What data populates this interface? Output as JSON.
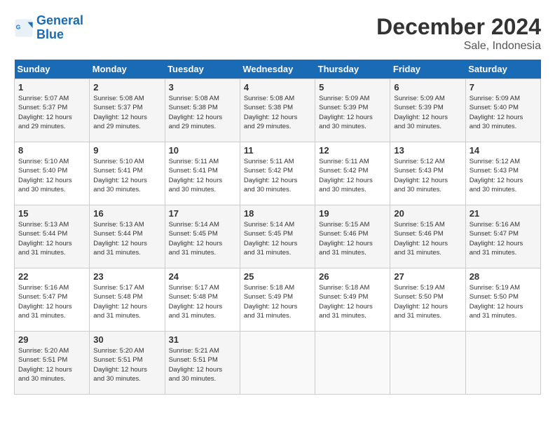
{
  "header": {
    "logo_line1": "General",
    "logo_line2": "Blue",
    "title": "December 2024",
    "subtitle": "Sale, Indonesia"
  },
  "days_of_week": [
    "Sunday",
    "Monday",
    "Tuesday",
    "Wednesday",
    "Thursday",
    "Friday",
    "Saturday"
  ],
  "weeks": [
    [
      {
        "day": "1",
        "info": "Sunrise: 5:07 AM\nSunset: 5:37 PM\nDaylight: 12 hours\nand 29 minutes."
      },
      {
        "day": "2",
        "info": "Sunrise: 5:08 AM\nSunset: 5:37 PM\nDaylight: 12 hours\nand 29 minutes."
      },
      {
        "day": "3",
        "info": "Sunrise: 5:08 AM\nSunset: 5:38 PM\nDaylight: 12 hours\nand 29 minutes."
      },
      {
        "day": "4",
        "info": "Sunrise: 5:08 AM\nSunset: 5:38 PM\nDaylight: 12 hours\nand 29 minutes."
      },
      {
        "day": "5",
        "info": "Sunrise: 5:09 AM\nSunset: 5:39 PM\nDaylight: 12 hours\nand 30 minutes."
      },
      {
        "day": "6",
        "info": "Sunrise: 5:09 AM\nSunset: 5:39 PM\nDaylight: 12 hours\nand 30 minutes."
      },
      {
        "day": "7",
        "info": "Sunrise: 5:09 AM\nSunset: 5:40 PM\nDaylight: 12 hours\nand 30 minutes."
      }
    ],
    [
      {
        "day": "8",
        "info": "Sunrise: 5:10 AM\nSunset: 5:40 PM\nDaylight: 12 hours\nand 30 minutes."
      },
      {
        "day": "9",
        "info": "Sunrise: 5:10 AM\nSunset: 5:41 PM\nDaylight: 12 hours\nand 30 minutes."
      },
      {
        "day": "10",
        "info": "Sunrise: 5:11 AM\nSunset: 5:41 PM\nDaylight: 12 hours\nand 30 minutes."
      },
      {
        "day": "11",
        "info": "Sunrise: 5:11 AM\nSunset: 5:42 PM\nDaylight: 12 hours\nand 30 minutes."
      },
      {
        "day": "12",
        "info": "Sunrise: 5:11 AM\nSunset: 5:42 PM\nDaylight: 12 hours\nand 30 minutes."
      },
      {
        "day": "13",
        "info": "Sunrise: 5:12 AM\nSunset: 5:43 PM\nDaylight: 12 hours\nand 30 minutes."
      },
      {
        "day": "14",
        "info": "Sunrise: 5:12 AM\nSunset: 5:43 PM\nDaylight: 12 hours\nand 30 minutes."
      }
    ],
    [
      {
        "day": "15",
        "info": "Sunrise: 5:13 AM\nSunset: 5:44 PM\nDaylight: 12 hours\nand 31 minutes."
      },
      {
        "day": "16",
        "info": "Sunrise: 5:13 AM\nSunset: 5:44 PM\nDaylight: 12 hours\nand 31 minutes."
      },
      {
        "day": "17",
        "info": "Sunrise: 5:14 AM\nSunset: 5:45 PM\nDaylight: 12 hours\nand 31 minutes."
      },
      {
        "day": "18",
        "info": "Sunrise: 5:14 AM\nSunset: 5:45 PM\nDaylight: 12 hours\nand 31 minutes."
      },
      {
        "day": "19",
        "info": "Sunrise: 5:15 AM\nSunset: 5:46 PM\nDaylight: 12 hours\nand 31 minutes."
      },
      {
        "day": "20",
        "info": "Sunrise: 5:15 AM\nSunset: 5:46 PM\nDaylight: 12 hours\nand 31 minutes."
      },
      {
        "day": "21",
        "info": "Sunrise: 5:16 AM\nSunset: 5:47 PM\nDaylight: 12 hours\nand 31 minutes."
      }
    ],
    [
      {
        "day": "22",
        "info": "Sunrise: 5:16 AM\nSunset: 5:47 PM\nDaylight: 12 hours\nand 31 minutes."
      },
      {
        "day": "23",
        "info": "Sunrise: 5:17 AM\nSunset: 5:48 PM\nDaylight: 12 hours\nand 31 minutes."
      },
      {
        "day": "24",
        "info": "Sunrise: 5:17 AM\nSunset: 5:48 PM\nDaylight: 12 hours\nand 31 minutes."
      },
      {
        "day": "25",
        "info": "Sunrise: 5:18 AM\nSunset: 5:49 PM\nDaylight: 12 hours\nand 31 minutes."
      },
      {
        "day": "26",
        "info": "Sunrise: 5:18 AM\nSunset: 5:49 PM\nDaylight: 12 hours\nand 31 minutes."
      },
      {
        "day": "27",
        "info": "Sunrise: 5:19 AM\nSunset: 5:50 PM\nDaylight: 12 hours\nand 31 minutes."
      },
      {
        "day": "28",
        "info": "Sunrise: 5:19 AM\nSunset: 5:50 PM\nDaylight: 12 hours\nand 31 minutes."
      }
    ],
    [
      {
        "day": "29",
        "info": "Sunrise: 5:20 AM\nSunset: 5:51 PM\nDaylight: 12 hours\nand 30 minutes."
      },
      {
        "day": "30",
        "info": "Sunrise: 5:20 AM\nSunset: 5:51 PM\nDaylight: 12 hours\nand 30 minutes."
      },
      {
        "day": "31",
        "info": "Sunrise: 5:21 AM\nSunset: 5:51 PM\nDaylight: 12 hours\nand 30 minutes."
      },
      {
        "day": "",
        "info": ""
      },
      {
        "day": "",
        "info": ""
      },
      {
        "day": "",
        "info": ""
      },
      {
        "day": "",
        "info": ""
      }
    ]
  ]
}
